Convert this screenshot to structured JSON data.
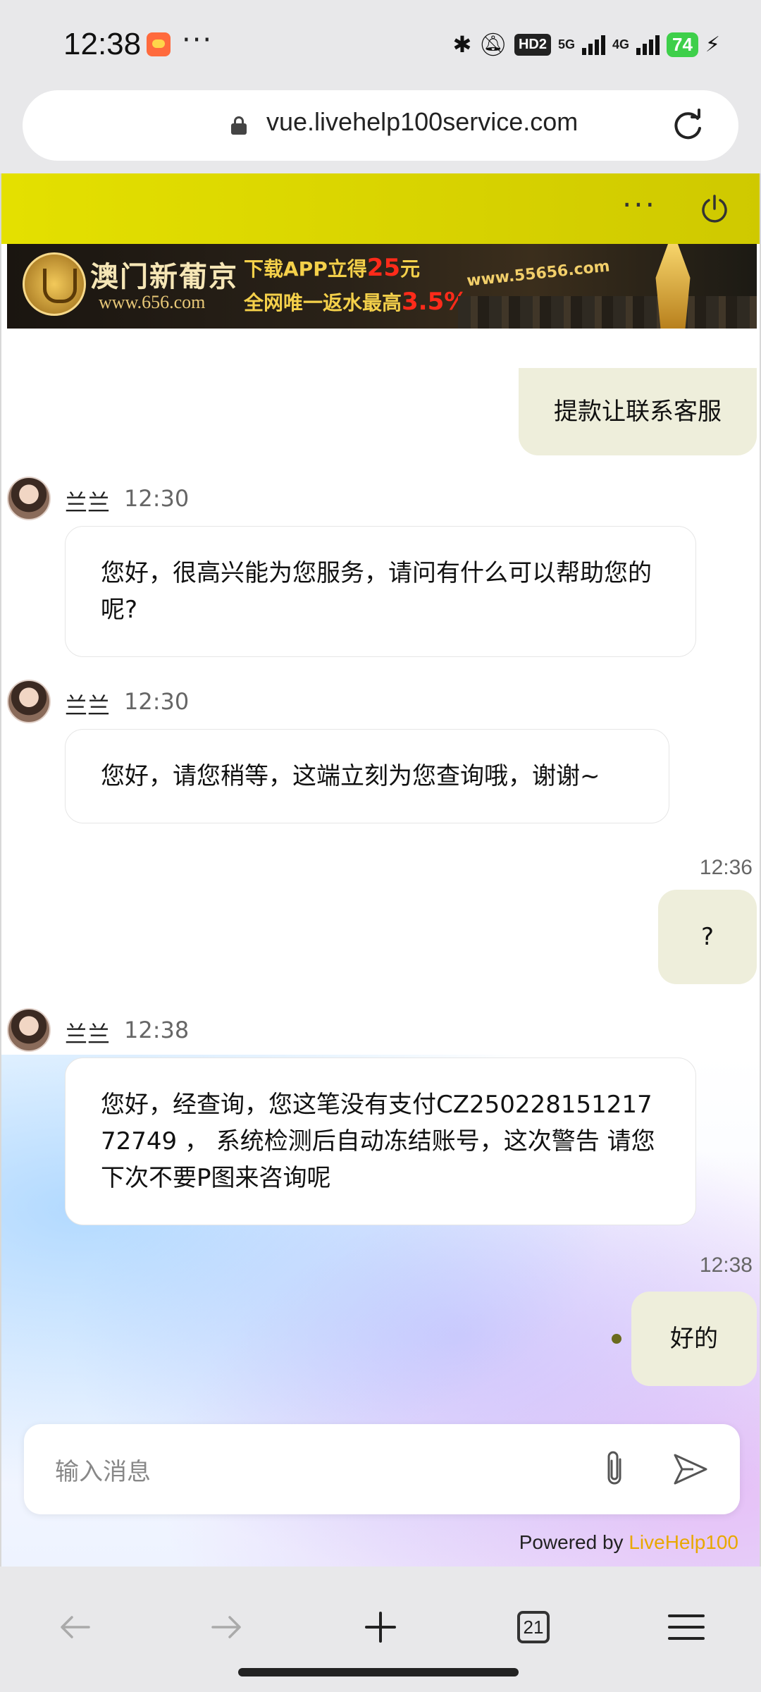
{
  "status_bar": {
    "time": "12:38",
    "more": "···",
    "hd": "HD2",
    "net_5g": "5G",
    "net_4g": "4G",
    "battery": "74"
  },
  "browser": {
    "url": "vue.livehelp100service.com",
    "tab_count": "21"
  },
  "topbar": {
    "more_label": "···"
  },
  "banner": {
    "brand": "澳门新葡京",
    "brand_url": "www.656.com",
    "promo_line1_prefix": "下载APP立得",
    "promo_line1_highlight": "25",
    "promo_line1_suffix": "元",
    "promo_line2_prefix": "全网唯一返水最高",
    "promo_line2_highlight": "3.5%",
    "site": "www.55656.com"
  },
  "messages": [
    {
      "type": "out",
      "text": "提款让联系客服"
    },
    {
      "type": "in",
      "sender": "兰兰",
      "time": "12:30",
      "text": "您好，很高兴能为您服务，请问有什么可以帮助您的呢?"
    },
    {
      "type": "in",
      "sender": "兰兰",
      "time": "12:30",
      "text": "您好，请您稍等，这端立刻为您查询哦，谢谢~"
    },
    {
      "type": "out",
      "time": "12:36",
      "text": "?"
    },
    {
      "type": "in",
      "sender": "兰兰",
      "time": "12:38",
      "text": "您好，经查询，您这笔没有支付CZ25022815121772749 ， 系统检测后自动冻结账号，这次警告 请您下次不要P图来咨询呢"
    },
    {
      "type": "out",
      "time": "12:38",
      "text": "好的"
    }
  ],
  "input": {
    "placeholder": "输入消息"
  },
  "footer": {
    "powered_prefix": "Powered by ",
    "powered_brand": "LiveHelp100"
  },
  "icons": {
    "bluetooth": "bluetooth-icon",
    "mute": "bell-off-icon",
    "lock": "lock-icon",
    "reload": "reload-icon",
    "power": "power-icon",
    "attach": "paperclip-icon",
    "send": "send-icon"
  },
  "colors": {
    "topbar": "#d9d400",
    "out_bubble": "#eeeedb",
    "brand_accent": "#e8a800"
  }
}
